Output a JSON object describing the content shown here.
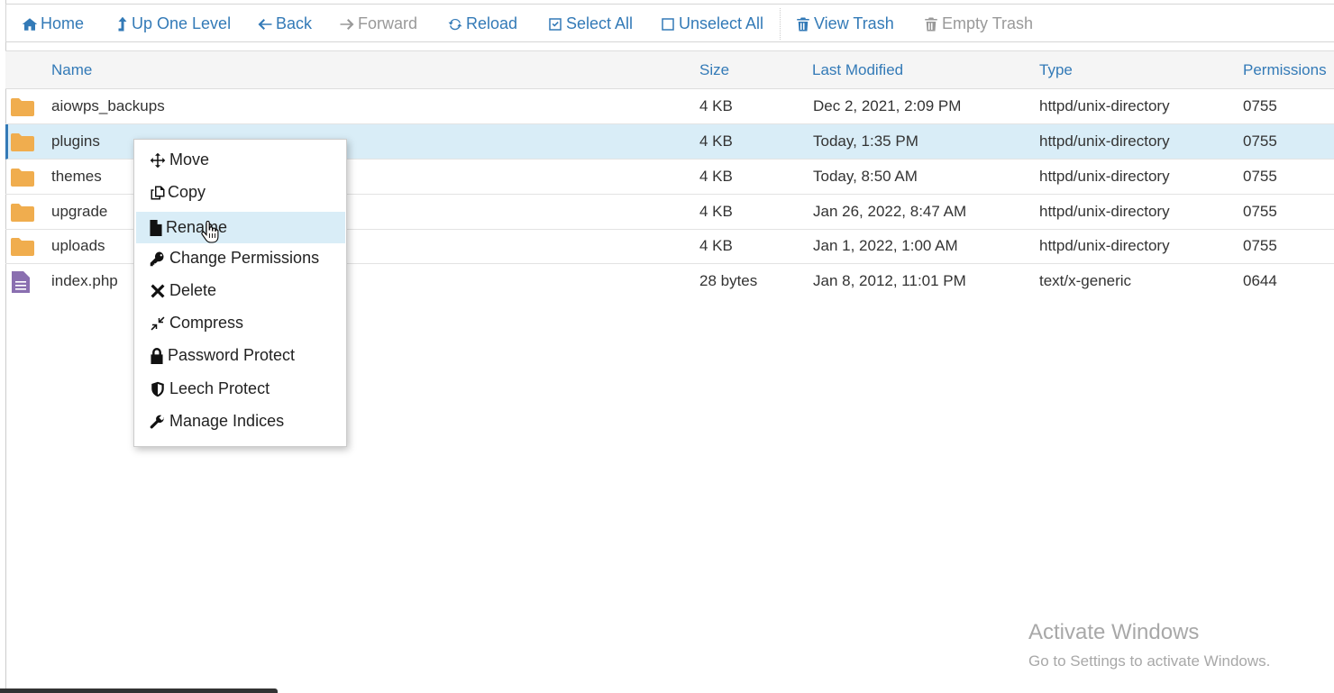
{
  "toolbar": {
    "home": "Home",
    "up_one_level": "Up One Level",
    "back": "Back",
    "forward": "Forward",
    "reload": "Reload",
    "select_all": "Select All",
    "unselect_all": "Unselect All",
    "view_trash": "View Trash",
    "empty_trash": "Empty Trash"
  },
  "table": {
    "headers": {
      "name": "Name",
      "size": "Size",
      "last_modified": "Last Modified",
      "type": "Type",
      "permissions": "Permissions"
    },
    "rows": [
      {
        "icon": "folder-icon",
        "name": "aiowps_backups",
        "size": "4 KB",
        "modified": "Dec 2, 2021, 2:09 PM",
        "type": "httpd/unix-directory",
        "perms": "0755"
      },
      {
        "icon": "folder-icon",
        "name": "plugins",
        "size": "4 KB",
        "modified": "Today, 1:35 PM",
        "type": "httpd/unix-directory",
        "perms": "0755"
      },
      {
        "icon": "folder-icon",
        "name": "themes",
        "size": "4 KB",
        "modified": "Today, 8:50 AM",
        "type": "httpd/unix-directory",
        "perms": "0755"
      },
      {
        "icon": "folder-icon",
        "name": "upgrade",
        "size": "4 KB",
        "modified": "Jan 26, 2022, 8:47 AM",
        "type": "httpd/unix-directory",
        "perms": "0755"
      },
      {
        "icon": "folder-icon",
        "name": "uploads",
        "size": "4 KB",
        "modified": "Jan 1, 2022, 1:00 AM",
        "type": "httpd/unix-directory",
        "perms": "0755"
      },
      {
        "icon": "file-text-icon",
        "name": "index.php",
        "size": "28 bytes",
        "modified": "Jan 8, 2012, 11:01 PM",
        "type": "text/x-generic",
        "perms": "0644"
      }
    ]
  },
  "context_menu": {
    "items": [
      {
        "icon": "move-icon",
        "label": "Move"
      },
      {
        "icon": "copy-icon",
        "label": "Copy"
      },
      {
        "icon": "file-icon",
        "label": "Rename"
      },
      {
        "icon": "key-icon",
        "label": "Change Permissions"
      },
      {
        "icon": "close-icon",
        "label": "Delete"
      },
      {
        "icon": "compress-icon",
        "label": "Compress"
      },
      {
        "icon": "lock-icon",
        "label": "Password Protect"
      },
      {
        "icon": "shield-icon",
        "label": "Leech Protect"
      },
      {
        "icon": "wrench-icon",
        "label": "Manage Indices"
      }
    ]
  },
  "watermark": {
    "title": "Activate Windows",
    "subtitle": "Go to Settings to activate Windows."
  },
  "colors": {
    "link": "#337ab7",
    "selected_row": "#d9edf7",
    "folder": "#f0ad4e",
    "file": "#8a6fb0"
  }
}
